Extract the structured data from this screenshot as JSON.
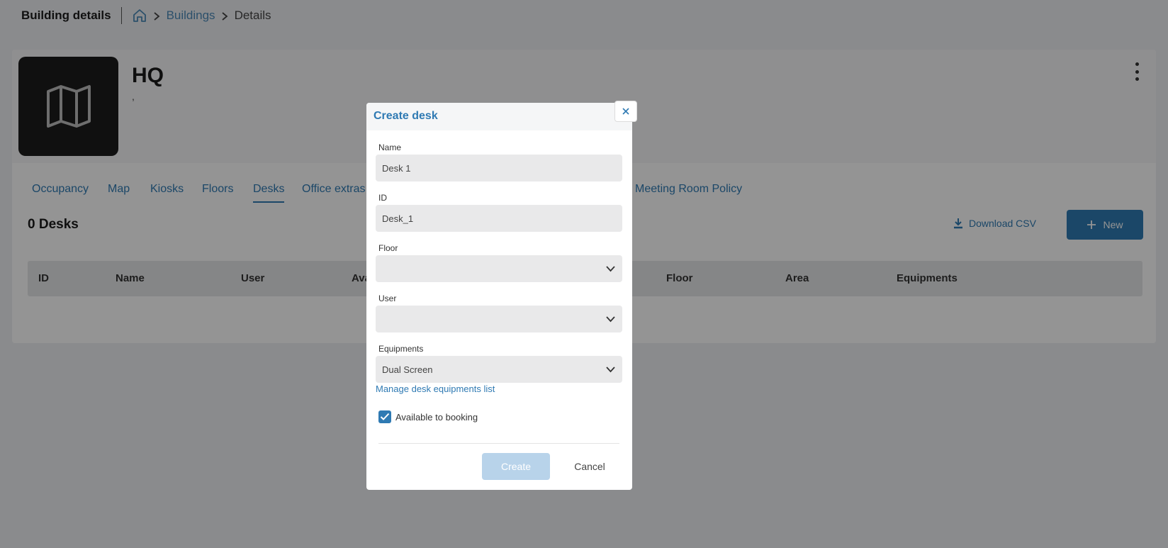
{
  "header": {
    "title": "Building details",
    "breadcrumb": {
      "home_icon": "home-icon",
      "link": "Buildings",
      "current": "Details"
    }
  },
  "building": {
    "name": "HQ",
    "subtitle": ",",
    "image_icon": "map-icon",
    "menu_icon": "kebab-menu-icon"
  },
  "tabs": [
    {
      "label": "Occupancy",
      "active": false
    },
    {
      "label": "Map",
      "active": false
    },
    {
      "label": "Kiosks",
      "active": false
    },
    {
      "label": "Floors",
      "active": false
    },
    {
      "label": "Desks",
      "active": true
    },
    {
      "label": "Office extras",
      "active": false
    },
    {
      "label": "Meeting Room Policy",
      "active": false
    }
  ],
  "desks": {
    "count_label": "0 Desks",
    "download_label": "Download CSV",
    "new_label": "New",
    "columns": [
      "ID",
      "Name",
      "User",
      "Ava",
      "Floor",
      "Area",
      "Equipments"
    ]
  },
  "modal": {
    "title": "Create desk",
    "close_icon": "close-icon",
    "fields": {
      "name": {
        "label": "Name",
        "value": "Desk 1"
      },
      "id": {
        "label": "ID",
        "value": "Desk_1"
      },
      "floor": {
        "label": "Floor",
        "value": ""
      },
      "user": {
        "label": "User",
        "value": ""
      },
      "equipments": {
        "label": "Equipments",
        "value": "Dual Screen"
      }
    },
    "manage_link": "Manage desk equipments list",
    "available_label": "Available to booking",
    "available_checked": true,
    "create_label": "Create",
    "cancel_label": "Cancel"
  },
  "colors": {
    "accent": "#2f7ab3",
    "overlay": "rgba(0,0,0,0.42)",
    "create_disabled": "#b8d3ea"
  }
}
